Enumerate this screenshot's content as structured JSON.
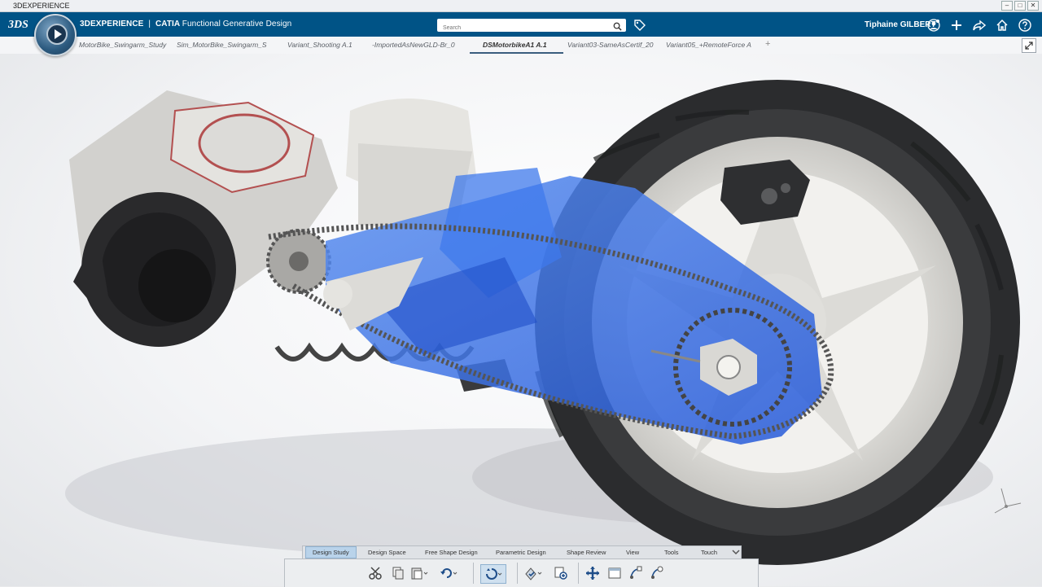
{
  "window": {
    "title": "3DEXPERIENCE",
    "controls": [
      "–",
      "□",
      "✕"
    ]
  },
  "appbar": {
    "brand": "3DEXPERIENCE",
    "separator": "|",
    "product_name": "CATIA",
    "app_name": "Functional Generative Design",
    "search_placeholder": "Search",
    "user_name": "Tiphaine GILBERT",
    "icons": [
      "user-icon",
      "plus-icon",
      "share-icon",
      "home-icon",
      "help-icon"
    ],
    "accent_color": "#005386"
  },
  "tabs": [
    {
      "label": "MotorBike_Swingarm_Study"
    },
    {
      "label": "Sim_MotorBike_Swingarm_S"
    },
    {
      "label": "Variant_Shooting A.1"
    },
    {
      "label": "-ImportedAsNewGLD-Br_0"
    },
    {
      "label": "DSMotorbikeA1 A.1",
      "active": true
    },
    {
      "label": "Variant03-SameAsCertif_20"
    },
    {
      "label": "Variant05_+RemoteForce A"
    }
  ],
  "action_tabs": [
    "Design Study",
    "Design Space",
    "Free Shape Design",
    "Parametric Design",
    "Shape Review",
    "View",
    "Tools",
    "Touch"
  ],
  "active_action_tab": "Design Study",
  "toolbar_icons": [
    "cut-icon",
    "copy-icon",
    "paste-icon",
    "undo-icon",
    "update-icon",
    "design-check-icon",
    "add-feature-icon",
    "robot-icon",
    "section-view-icon",
    "edit-shape-icon",
    "refine-shape-icon"
  ],
  "viewport": {
    "model": "motorbike swingarm assembly",
    "highlight_color": "#2f6fe8"
  }
}
